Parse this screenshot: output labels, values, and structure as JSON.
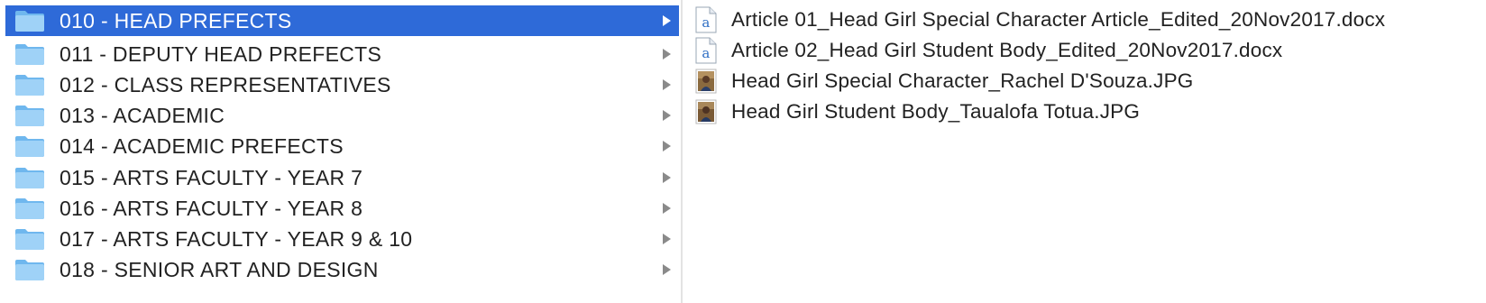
{
  "folders": [
    {
      "label": "010 - HEAD PREFECTS",
      "selected": true
    },
    {
      "label": "011 - DEPUTY HEAD PREFECTS",
      "selected": false
    },
    {
      "label": "012 - CLASS REPRESENTATIVES",
      "selected": false
    },
    {
      "label": "013 - ACADEMIC",
      "selected": false
    },
    {
      "label": "014 - ACADEMIC PREFECTS",
      "selected": false
    },
    {
      "label": "015 - ARTS FACULTY - YEAR 7",
      "selected": false
    },
    {
      "label": "016 - ARTS FACULTY - YEAR 8",
      "selected": false
    },
    {
      "label": "017 - ARTS FACULTY - YEAR 9 & 10",
      "selected": false
    },
    {
      "label": "018 - SENIOR ART AND DESIGN",
      "selected": false
    }
  ],
  "files": [
    {
      "name": "Article 01_Head Girl Special Character Article_Edited_20Nov2017.docx",
      "icon": "word-document-icon"
    },
    {
      "name": "Article 02_Head Girl Student Body_Edited_20Nov2017.docx",
      "icon": "word-document-icon"
    },
    {
      "name": "Head Girl Special Character_Rachel D'Souza.JPG",
      "icon": "photo-thumbnail-icon"
    },
    {
      "name": "Head Girl Student Body_Taualofa Totua.JPG",
      "icon": "photo-thumbnail-icon"
    }
  ],
  "icons": {
    "folder": "folder-icon",
    "disclosure": "chevron-right-icon"
  },
  "colors": {
    "selection": "#2e6ad8",
    "folder_fill": "#7cc0f0",
    "text": "#222222"
  }
}
